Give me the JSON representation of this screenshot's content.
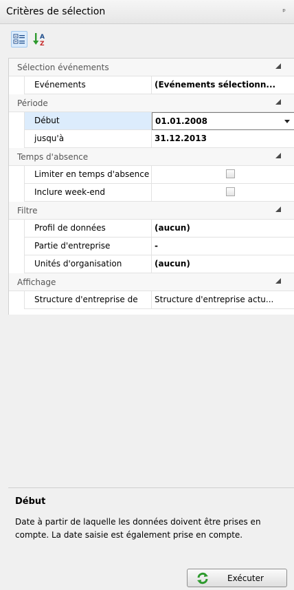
{
  "panel": {
    "title": "Critères de sélection",
    "pin_glyph": "ᵖ"
  },
  "toolbar": {
    "categorized_icon": "categorized-view-icon",
    "sort_icon": "sort-az-icon"
  },
  "grid": {
    "cat_events": "Sélection événements",
    "events_name": "Evénements",
    "events_value": "(Evénements sélectionn...",
    "cat_period": "Période",
    "start_name": "Début",
    "start_value": "01.01.2008",
    "end_name": "jusqu'à",
    "end_value": "31.12.2013",
    "cat_absence": "Temps d'absence",
    "limit_name": "Limiter en temps d'absence",
    "weekend_name": "Inclure week-end",
    "cat_filter": "Filtre",
    "profile_name": "Profil de données",
    "profile_value": "(aucun)",
    "company_part_name": "Partie d'entreprise",
    "company_part_value": "-",
    "org_units_name": "Unités d'organisation",
    "org_units_value": "(aucun)",
    "cat_display": "Affichage",
    "structure_name": "Structure d'entreprise de",
    "structure_value": "Structure d'entreprise actu..."
  },
  "help": {
    "title": "Début",
    "text": "Date à partir de laquelle les données doivent être prises en compte. La date saisie est également prise en compte."
  },
  "execute": {
    "label": "Exécuter",
    "icon": "refresh-icon"
  }
}
